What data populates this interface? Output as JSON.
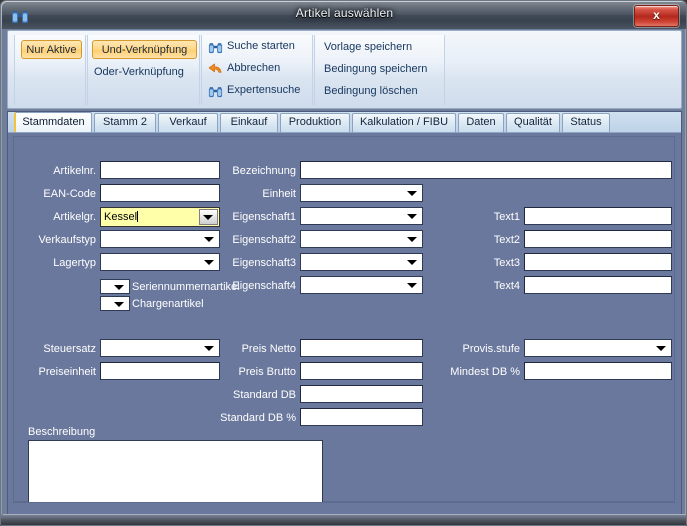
{
  "window": {
    "title": "Artikel auswählen",
    "title_icon": "binoculars-icon",
    "close_label": "x",
    "colors": {
      "form_background": "#6a789d",
      "accent_toggle": "#ffd98c",
      "active_tab_marker": "#f2c340",
      "highlight_field": "#ffffaa",
      "close_button": "#b3281c"
    }
  },
  "ribbon": {
    "group1": {
      "buttons": [
        {
          "label": "Nur Aktive",
          "active": true
        }
      ]
    },
    "group2": {
      "buttons": [
        {
          "label": "Und-Verknüpfung",
          "active": true
        },
        {
          "label": "Oder-Verknüpfung",
          "active": false
        }
      ]
    },
    "group3": {
      "buttons": [
        {
          "label": "Suche starten",
          "icon": "binoculars-icon"
        },
        {
          "label": "Abbrechen",
          "icon": "undo-arrow-icon"
        },
        {
          "label": "Expertensuche",
          "icon": "binoculars-icon"
        }
      ]
    },
    "group4": {
      "buttons": [
        {
          "label": "Vorlage speichern"
        },
        {
          "label": "Bedingung speichern"
        },
        {
          "label": "Bedingung löschen"
        }
      ]
    }
  },
  "tabs": [
    {
      "label": "Stammdaten",
      "active": true
    },
    {
      "label": "Stamm 2",
      "active": false
    },
    {
      "label": "Verkauf",
      "active": false
    },
    {
      "label": "Einkauf",
      "active": false
    },
    {
      "label": "Produktion",
      "active": false
    },
    {
      "label": "Kalkulation / FIBU",
      "active": false
    },
    {
      "label": "Daten",
      "active": false
    },
    {
      "label": "Qualität",
      "active": false
    },
    {
      "label": "Status",
      "active": false
    }
  ],
  "form": {
    "fields": {
      "artikelnr": {
        "label": "Artikelnr.",
        "value": ""
      },
      "ean_code": {
        "label": "EAN-Code",
        "value": ""
      },
      "artikelgr": {
        "label": "Artikelgr.",
        "value": "Kessel"
      },
      "verkaufstyp": {
        "label": "Verkaufstyp",
        "value": ""
      },
      "lagertyp": {
        "label": "Lagertyp",
        "value": ""
      },
      "seriennummer": {
        "label": "Seriennummernartikel",
        "value": ""
      },
      "chargenartikel": {
        "label": "Chargenartikel",
        "value": ""
      },
      "bezeichnung": {
        "label": "Bezeichnung",
        "value": ""
      },
      "einheit": {
        "label": "Einheit",
        "value": ""
      },
      "eigenschaft1": {
        "label": "Eigenschaft1",
        "value": ""
      },
      "eigenschaft2": {
        "label": "Eigenschaft2",
        "value": ""
      },
      "eigenschaft3": {
        "label": "Eigenschaft3",
        "value": ""
      },
      "eigenschaft4": {
        "label": "Eigenschaft4",
        "value": ""
      },
      "text1": {
        "label": "Text1",
        "value": ""
      },
      "text2": {
        "label": "Text2",
        "value": ""
      },
      "text3": {
        "label": "Text3",
        "value": ""
      },
      "text4": {
        "label": "Text4",
        "value": ""
      },
      "steuersatz": {
        "label": "Steuersatz",
        "value": ""
      },
      "preiseinheit": {
        "label": "Preiseinheit",
        "value": ""
      },
      "preis_netto": {
        "label": "Preis Netto",
        "value": ""
      },
      "preis_brutto": {
        "label": "Preis Brutto",
        "value": ""
      },
      "standard_db": {
        "label": "Standard DB",
        "value": ""
      },
      "standard_db_pct": {
        "label": "Standard DB %",
        "value": ""
      },
      "provis_stufe": {
        "label": "Provis.stufe",
        "value": ""
      },
      "mindest_db_pct": {
        "label": "Mindest DB %",
        "value": ""
      },
      "beschreibung": {
        "label": "Beschreibung",
        "value": ""
      }
    }
  }
}
